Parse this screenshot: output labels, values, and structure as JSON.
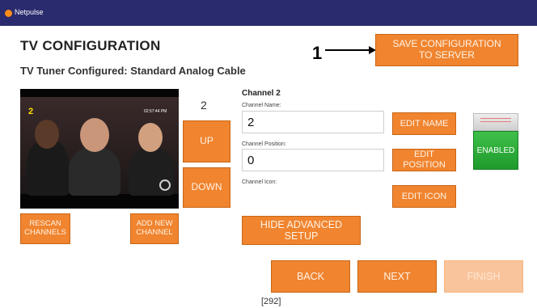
{
  "app": {
    "name": "Netpulse"
  },
  "page": {
    "title": "TV CONFIGURATION",
    "subtitle": "TV Tuner Configured: Standard Analog Cable"
  },
  "annotation": {
    "label": "1"
  },
  "buttons": {
    "save": "SAVE CONFIGURATION TO SERVER",
    "up": "UP",
    "down": "DOWN",
    "rescan": "RESCAN CHANNELS",
    "add_channel": "ADD NEW CHANNEL",
    "edit_name": "EDIT NAME",
    "edit_position": "EDIT POSITION",
    "edit_icon": "EDIT ICON",
    "hide_advanced": "HIDE ADVANCED SETUP",
    "back": "BACK",
    "next": "NEXT",
    "finish": "FINISH"
  },
  "preview": {
    "channel_overlay": "2",
    "time_overlay": "02:57:44 PM"
  },
  "channel_number": "2",
  "channel": {
    "header": "Channel 2",
    "name_label": "Channel Name:",
    "name_value": "2",
    "position_label": "Channel Position:",
    "position_value": "0",
    "icon_label": "Channel Icon:"
  },
  "toggle": {
    "label": "ENABLED",
    "state": "enabled"
  },
  "footer": {
    "counter": "[292]"
  },
  "colors": {
    "accent": "#f0842f",
    "titlebar": "#2a2a6e",
    "enabled": "#2aa537",
    "disabled_button": "#f9c49b"
  }
}
